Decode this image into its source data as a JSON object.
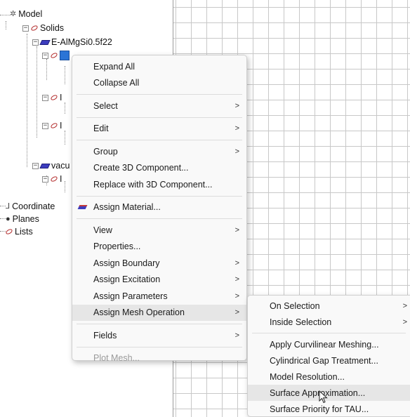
{
  "tree": {
    "model": "Model",
    "solids": "Solids",
    "material": "E-AlMgSi0.5f22",
    "child1": "I",
    "child2": "I",
    "vacuum": "vacu",
    "vacuum_child": "I",
    "coordinate": "Coordinate",
    "planes": "Planes",
    "lists": "Lists"
  },
  "context_menu": {
    "items": [
      {
        "label": "Expand All"
      },
      {
        "label": "Collapse All"
      },
      {
        "label": "Select",
        "submenu": ">"
      },
      {
        "label": "Edit",
        "submenu": ">"
      },
      {
        "label": "Group",
        "submenu": ">"
      },
      {
        "label": "Create 3D Component..."
      },
      {
        "label": "Replace with 3D Component..."
      },
      {
        "label": "Assign Material..."
      },
      {
        "label": "View",
        "submenu": ">"
      },
      {
        "label": "Properties..."
      },
      {
        "label": "Assign Boundary",
        "submenu": ">"
      },
      {
        "label": "Assign Excitation",
        "submenu": ">"
      },
      {
        "label": "Assign Parameters",
        "submenu": ">"
      },
      {
        "label": "Assign Mesh Operation",
        "submenu": ">"
      },
      {
        "label": "Fields",
        "submenu": ">"
      },
      {
        "label": "Plot Mesh..."
      }
    ]
  },
  "submenu": {
    "items": [
      {
        "label": "On Selection",
        "submenu": ">"
      },
      {
        "label": "Inside Selection",
        "submenu": ">"
      },
      {
        "label": "Apply Curvilinear Meshing..."
      },
      {
        "label": "Cylindrical Gap Treatment..."
      },
      {
        "label": "Model Resolution..."
      },
      {
        "label": "Surface Approximation..."
      },
      {
        "label": "Surface Priority for TAU..."
      }
    ]
  },
  "colors": {
    "highlight": "#e6e6e6",
    "selection": "#2b74d6",
    "grid_line": "#c8c8c8"
  }
}
